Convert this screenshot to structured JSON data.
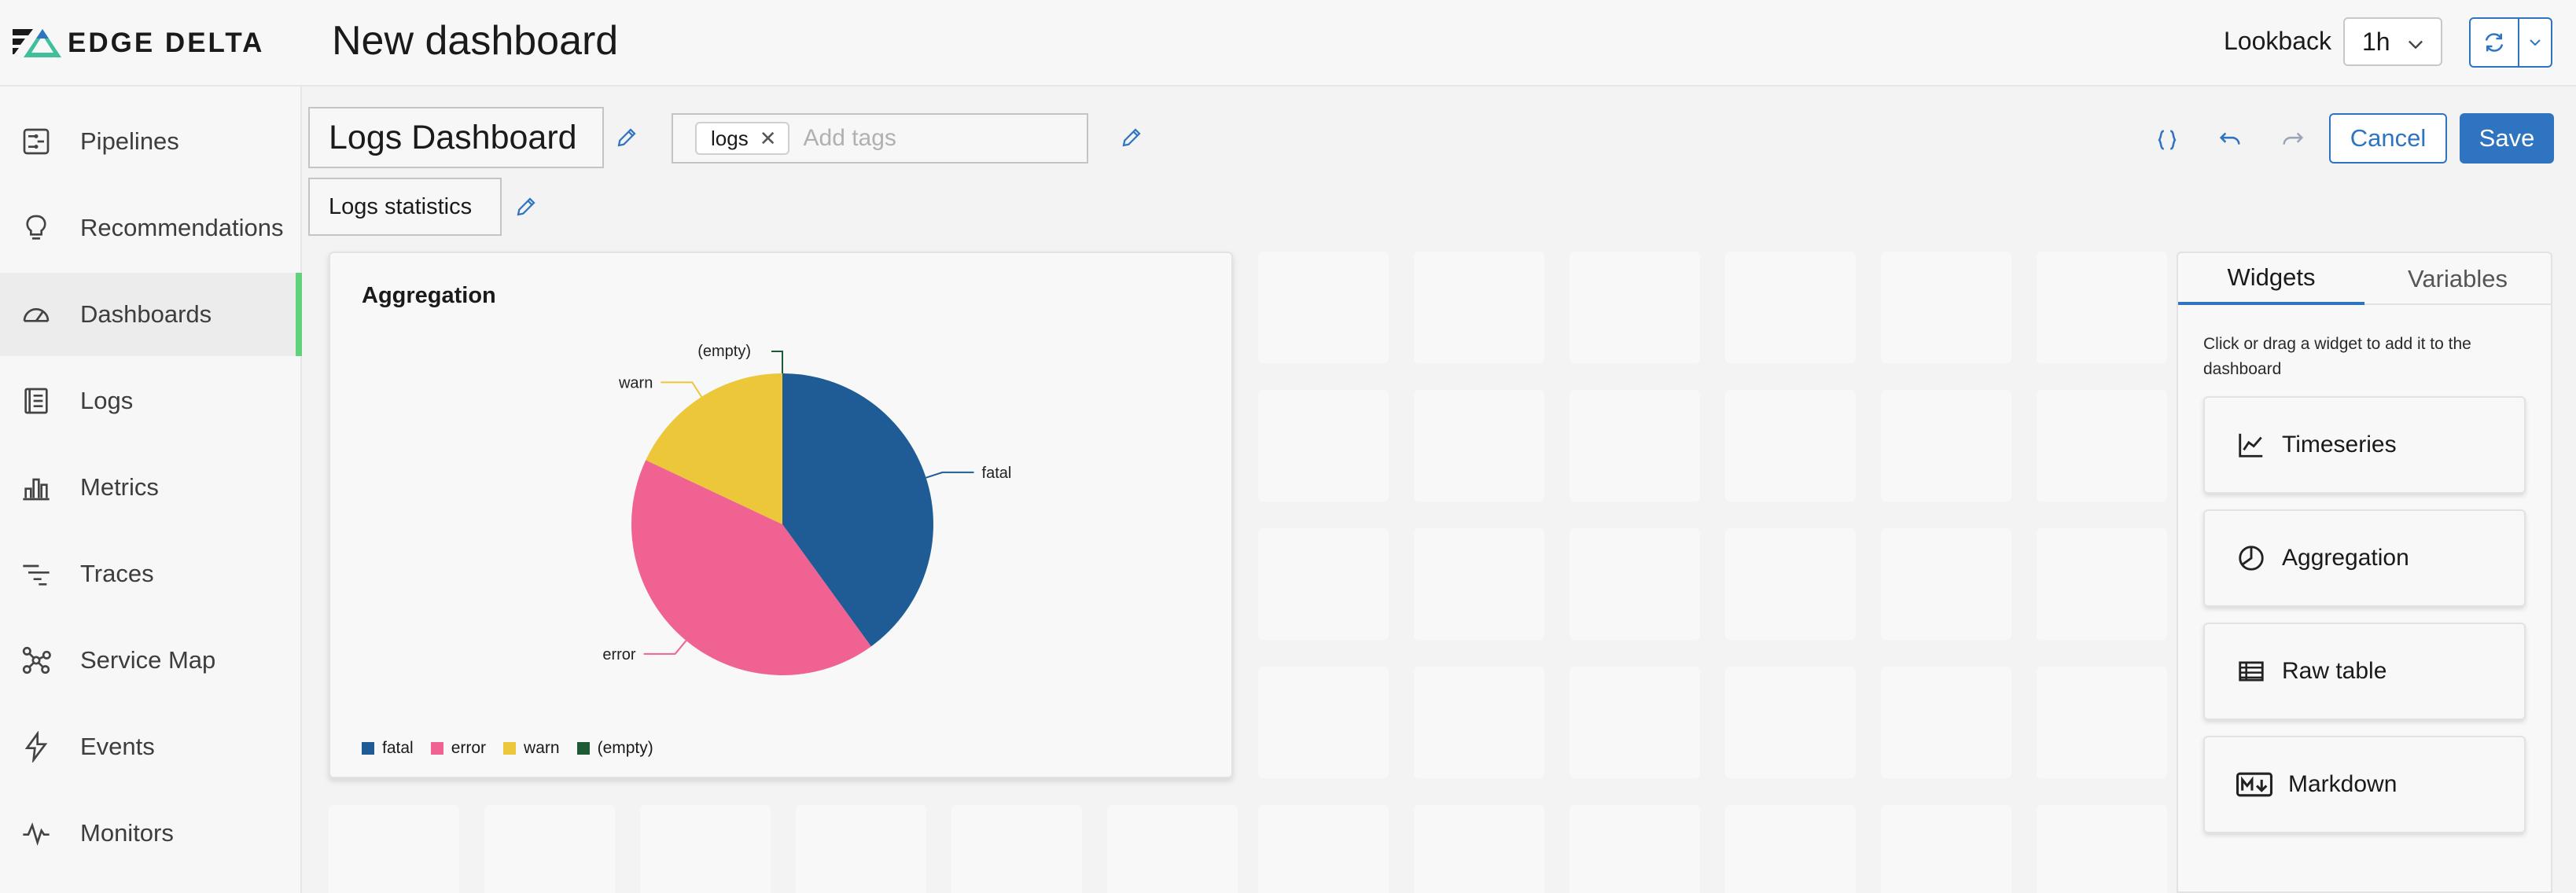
{
  "brand": {
    "name": "EDGE DELTA"
  },
  "header": {
    "title": "New dashboard",
    "lookback_label": "Lookback",
    "lookback_value": "1h"
  },
  "sidebar": {
    "items": [
      {
        "label": "Pipelines",
        "icon": "pipelines-icon"
      },
      {
        "label": "Recommendations",
        "icon": "lightbulb-icon"
      },
      {
        "label": "Dashboards",
        "icon": "gauge-icon",
        "active": true
      },
      {
        "label": "Logs",
        "icon": "logs-icon"
      },
      {
        "label": "Metrics",
        "icon": "bar-chart-icon"
      },
      {
        "label": "Traces",
        "icon": "traces-icon"
      },
      {
        "label": "Service Map",
        "icon": "service-map-icon"
      },
      {
        "label": "Events",
        "icon": "lightning-icon"
      },
      {
        "label": "Monitors",
        "icon": "pulse-icon"
      }
    ],
    "active_color": "#5fd27a"
  },
  "dashboard": {
    "title": "Logs Dashboard",
    "tag": "logs",
    "tags_placeholder": "Add tags",
    "subtitle": "Logs statistics",
    "cancel_label": "Cancel",
    "save_label": "Save",
    "accent_color": "#2f74c0"
  },
  "widget": {
    "title": "Aggregation",
    "chart_data": {
      "type": "pie",
      "title": "Aggregation",
      "slices": [
        {
          "label": "fatal",
          "value": 40,
          "color": "#1f5c96"
        },
        {
          "label": "error",
          "value": 42,
          "color": "#f06292"
        },
        {
          "label": "warn",
          "value": 18,
          "color": "#ecc73a"
        },
        {
          "label": "(empty)",
          "value": 0,
          "color": "#1e5a34"
        }
      ],
      "legend_position": "bottom-left"
    }
  },
  "panel": {
    "tabs": [
      "Widgets",
      "Variables"
    ],
    "active_tab": "Widgets",
    "help_text": "Click or drag a widget to add it to the dashboard",
    "widgets": [
      {
        "label": "Timeseries",
        "icon": "line-chart-icon"
      },
      {
        "label": "Aggregation",
        "icon": "pie-chart-icon"
      },
      {
        "label": "Raw table",
        "icon": "table-icon"
      },
      {
        "label": "Markdown",
        "icon": "markdown-icon"
      }
    ]
  }
}
